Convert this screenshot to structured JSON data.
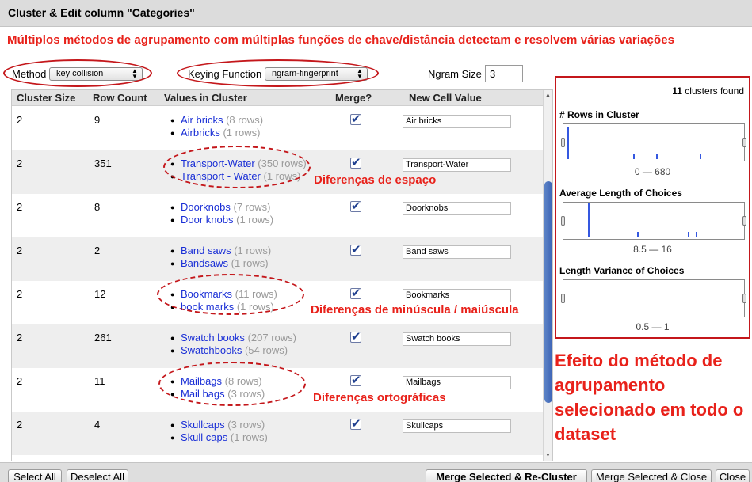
{
  "dialog": {
    "title": "Cluster & Edit column \"Categories\""
  },
  "headline": "Múltiplos métodos de agrupamento com múltiplas funções de chave/distância detectam e resolvem várias variações",
  "controls": {
    "method_label": "Method",
    "method_value": "key collision",
    "keying_label": "Keying Function",
    "keying_value": "ngram-fingerprint",
    "ngram_label": "Ngram Size",
    "ngram_value": "3"
  },
  "table": {
    "headers": [
      "Cluster Size",
      "Row Count",
      "Values in Cluster",
      "Merge?",
      "New Cell Value"
    ],
    "rows": [
      {
        "size": "2",
        "count": "9",
        "values": [
          {
            "v": "Air bricks",
            "c": "(8 rows)"
          },
          {
            "v": "Airbricks",
            "c": "(1 rows)"
          }
        ],
        "merge": true,
        "new": "Air bricks"
      },
      {
        "size": "2",
        "count": "351",
        "values": [
          {
            "v": "Transport-Water",
            "c": "(350 rows)"
          },
          {
            "v": "Transport - Water",
            "c": "(1 rows)"
          }
        ],
        "merge": true,
        "new": "Transport-Water"
      },
      {
        "size": "2",
        "count": "8",
        "values": [
          {
            "v": "Doorknobs",
            "c": "(7 rows)"
          },
          {
            "v": "Door knobs",
            "c": "(1 rows)"
          }
        ],
        "merge": true,
        "new": "Doorknobs"
      },
      {
        "size": "2",
        "count": "2",
        "values": [
          {
            "v": "Band saws",
            "c": "(1 rows)"
          },
          {
            "v": "Bandsaws",
            "c": "(1 rows)"
          }
        ],
        "merge": true,
        "new": "Band saws"
      },
      {
        "size": "2",
        "count": "12",
        "values": [
          {
            "v": "Bookmarks",
            "c": "(11 rows)"
          },
          {
            "v": "book marks",
            "c": "(1 rows)"
          }
        ],
        "merge": true,
        "new": "Bookmarks"
      },
      {
        "size": "2",
        "count": "261",
        "values": [
          {
            "v": "Swatch books",
            "c": "(207 rows)"
          },
          {
            "v": "Swatchbooks",
            "c": "(54 rows)"
          }
        ],
        "merge": true,
        "new": "Swatch books"
      },
      {
        "size": "2",
        "count": "11",
        "values": [
          {
            "v": "Mailbags",
            "c": "(8 rows)"
          },
          {
            "v": "Mail bags",
            "c": "(3 rows)"
          }
        ],
        "merge": true,
        "new": "Mailbags"
      },
      {
        "size": "2",
        "count": "4",
        "values": [
          {
            "v": "Skullcaps",
            "c": "(3 rows)"
          },
          {
            "v": "Skull caps",
            "c": "(1 rows)"
          }
        ],
        "merge": true,
        "new": "Skullcaps"
      }
    ]
  },
  "annotations": {
    "spacing": "Diferenças de espaço",
    "case": "Diferenças de minúscula / maiúscula",
    "spelling": "Diferenças ortográficas",
    "effect": "Efeito do método de agrupamento selecionado em todo o dataset"
  },
  "facets": {
    "clusters_count": "11",
    "clusters_label": "clusters found",
    "rows_title": "# Rows in Cluster",
    "rows_range": "0 — 680",
    "avg_title": "Average Length of Choices",
    "avg_range": "8.5 — 16",
    "var_title": "Length Variance of Choices",
    "var_range": "0.5 — 1",
    "bar_color": "#3558e0"
  },
  "footer": {
    "select_all": "Select All",
    "deselect_all": "Deselect All",
    "merge_recluster": "Merge Selected & Re-Cluster",
    "merge_close": "Merge Selected & Close",
    "close": "Close"
  }
}
